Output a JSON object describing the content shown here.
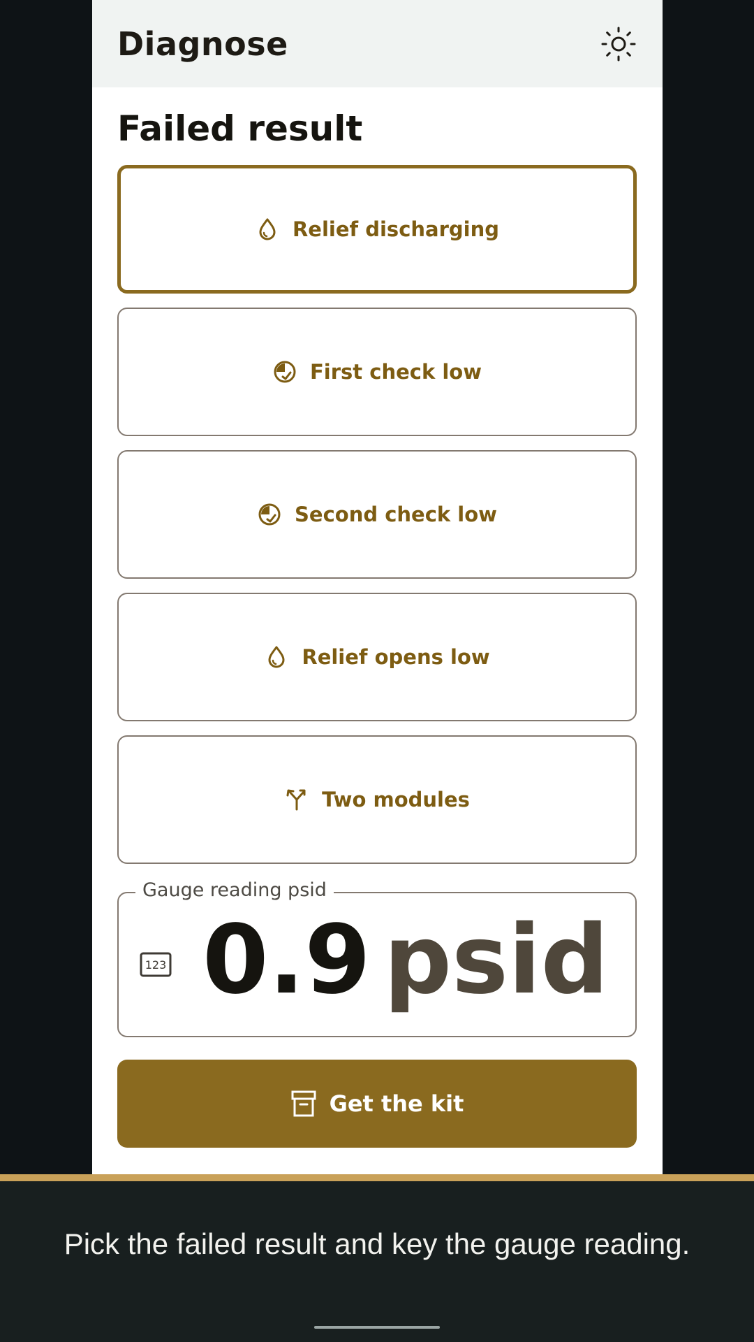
{
  "appbar": {
    "title": "Diagnose",
    "theme_icon": "sun-icon"
  },
  "section": {
    "title": "Failed result"
  },
  "options": [
    {
      "label": "Relief discharging",
      "icon": "drop-icon",
      "selected": true
    },
    {
      "label": "First check low",
      "icon": "gauge-check-icon",
      "selected": false
    },
    {
      "label": "Second check low",
      "icon": "gauge-check-icon",
      "selected": false
    },
    {
      "label": "Relief opens low",
      "icon": "drop-icon",
      "selected": false
    },
    {
      "label": "Two modules",
      "icon": "split-arrow-icon",
      "selected": false
    }
  ],
  "gauge": {
    "label": "Gauge reading psid",
    "value": "0.9",
    "unit": "psid",
    "icon": "number-pad-icon"
  },
  "action": {
    "label": "Get the kit",
    "icon": "archive-box-icon"
  },
  "caption": {
    "text": "Pick the failed result and key the gauge reading."
  },
  "colors": {
    "accent": "#8a6a1f",
    "accent_text": "#7d5c12",
    "caption_border": "#c9a159"
  }
}
